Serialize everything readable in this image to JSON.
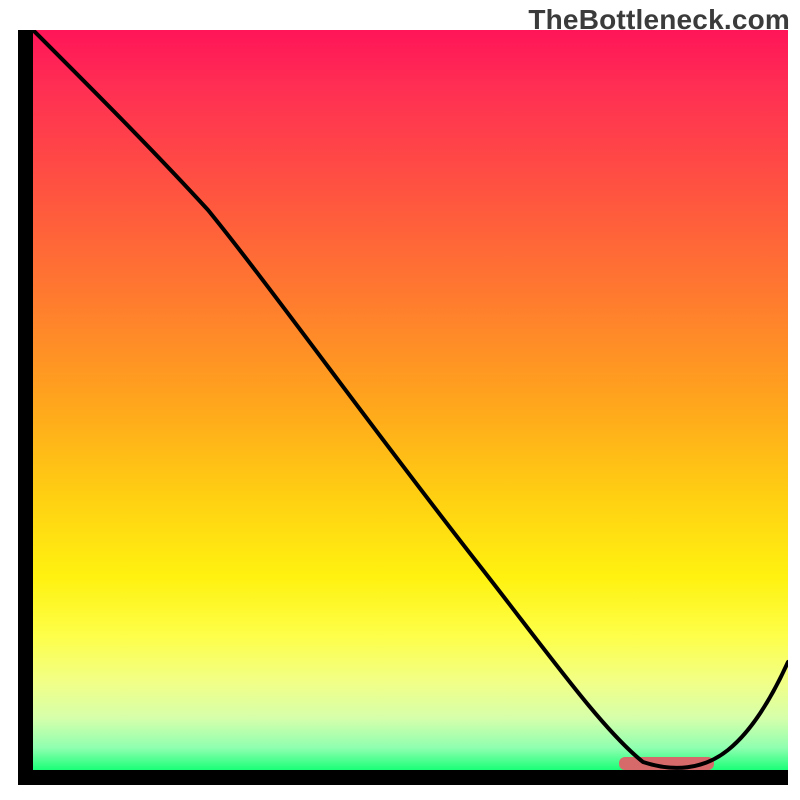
{
  "watermark": "TheBottleneck.com",
  "colors": {
    "axis": "#000000",
    "curve": "#000000",
    "marker": "#d66a6a",
    "gradient_top": "#ff1558",
    "gradient_bottom": "#1aff77"
  },
  "chart_data": {
    "type": "line",
    "title": "",
    "xlabel": "",
    "ylabel": "",
    "xlim": [
      0,
      100
    ],
    "ylim": [
      0,
      100
    ],
    "grid": false,
    "legend": false,
    "notes": "Background is a vertical gradient from red (top, high bottleneck) through orange/yellow to green (bottom, no bottleneck). Curve shows bottleneck vs. configuration; values estimated from plotted pixels.",
    "series": [
      {
        "name": "bottleneck_curve",
        "x": [
          0,
          8,
          16,
          23,
          30,
          38,
          46,
          54,
          62,
          70,
          76,
          82,
          88,
          94,
          100
        ],
        "y": [
          100,
          92,
          84,
          76,
          67,
          57,
          47,
          37,
          27,
          17,
          8,
          0,
          0,
          7,
          15
        ]
      }
    ],
    "optimal_band": {
      "x_start": 78,
      "x_end": 90,
      "y": 0
    }
  }
}
